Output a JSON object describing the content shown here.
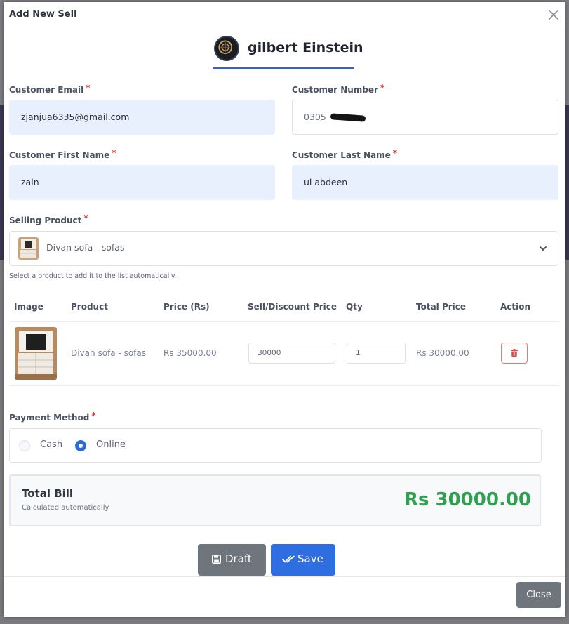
{
  "modal": {
    "title": "Add New Sell",
    "close_icon": "close-icon"
  },
  "shop": {
    "name": "gilbert Einstein"
  },
  "form": {
    "required_mark": "*",
    "customer_email": {
      "label": "Customer Email",
      "value": "zjanjua6335@gmail.com"
    },
    "customer_number": {
      "label": "Customer Number",
      "value": "0305"
    },
    "first_name": {
      "label": "Customer First Name",
      "value": "zain"
    },
    "last_name": {
      "label": "Customer Last Name",
      "value": "ul abdeen"
    },
    "selling_product": {
      "label": "Selling Product",
      "selected": "Divan sofa - sofas",
      "hint": "Select a product to add it to the list automatically."
    }
  },
  "table": {
    "headers": [
      "Image",
      "Product",
      "Price (Rs)",
      "Sell/Discount Price",
      "Qty",
      "Total Price",
      "Action"
    ],
    "rows": [
      {
        "product": "Divan sofa - sofas",
        "price": "Rs 35000.00",
        "sell_price": "30000",
        "qty": "1",
        "total": "Rs 30000.00"
      }
    ]
  },
  "payment": {
    "label": "Payment Method",
    "options": [
      "Cash",
      "Online"
    ],
    "selected": "Online"
  },
  "total": {
    "title": "Total Bill",
    "subtitle": "Calculated automatically",
    "amount": "Rs 30000.00"
  },
  "buttons": {
    "draft": "Draft",
    "save": "Save",
    "close": "Close"
  },
  "colors": {
    "primary": "#2f6ee0",
    "secondary": "#6e757c",
    "success": "#2fa04f",
    "danger": "#d93a3a",
    "input_fill": "#e8effd"
  }
}
